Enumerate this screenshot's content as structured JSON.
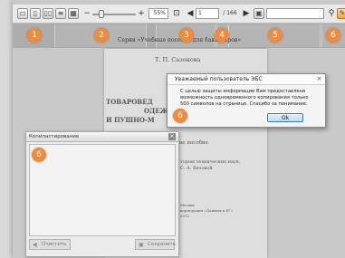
{
  "toolbar": {
    "zoom_value": "55%",
    "page_current": "1",
    "page_total": "/ 166",
    "search_value": ""
  },
  "markers": [
    "1",
    "2",
    "3",
    "4",
    "5",
    "6",
    "6",
    "6"
  ],
  "band_text": "Серия «Учебные пособия для бакалавров»",
  "document": {
    "author": "Т. П. Сазонова",
    "title_line1": "ТОВАРОВЕД",
    "title_line2": "ОДЕЖ",
    "title_line3": "И ПУШНО-М",
    "subtitle": "ое пособие",
    "line_a": "тором технических наук,",
    "line_b": "С. А. Вязовой",
    "line_c": "Москва",
    "line_d": "корпорация «Дашков и К°»",
    "line_e": "2012"
  },
  "dialog": {
    "title": "Уважаемый пользователь ЭБС",
    "close": "×",
    "message": "С целью защиты информации Вам предоставлена возможность одновременного копирования только 500 символов на странице. Спасибо за понимание.",
    "ok_label": "Ok"
  },
  "copy_panel": {
    "title": "Копипастирование",
    "close": "×",
    "clear_label": "Очистить",
    "save_label": "Сохранить"
  }
}
